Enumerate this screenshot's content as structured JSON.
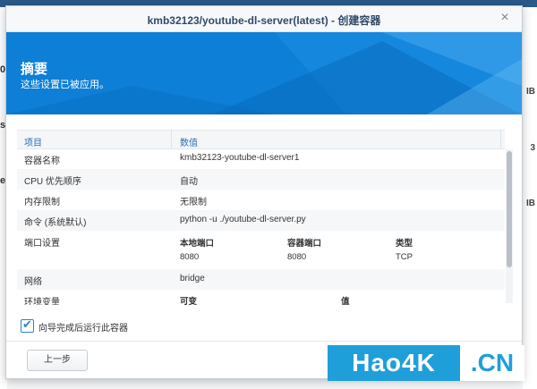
{
  "background": {
    "left_fragments": [
      "0",
      "s",
      "e"
    ],
    "right_fragments": [
      "IB",
      "3",
      "IB"
    ]
  },
  "dialog": {
    "title": "kmb32123/youtube-dl-server(latest) - 创建容器",
    "close_icon": "×",
    "banner": {
      "title": "摘要",
      "subtitle": "这些设置已被应用。"
    },
    "summary": {
      "headers": [
        "项目",
        "数值"
      ],
      "rows": [
        {
          "label": "容器名称",
          "value": "kmb32123-youtube-dl-server1"
        },
        {
          "label": "CPU 优先顺序",
          "value": "自动"
        },
        {
          "label": "内存限制",
          "value": "无限制"
        },
        {
          "label": "命令 (系统默认)",
          "value": "python -u ./youtube-dl-server.py"
        }
      ],
      "ports": {
        "label": "端口设置",
        "headers": [
          "本地端口",
          "容器端口",
          "类型"
        ],
        "values": [
          "8080",
          "8080",
          "TCP"
        ]
      },
      "network": {
        "label": "网络",
        "value": "bridge"
      },
      "env": {
        "label": "环境变量",
        "headers": [
          "可变",
          "值"
        ]
      }
    },
    "checkbox": {
      "label": "向导完成后运行此容器",
      "checked": true,
      "check_icon": "✔"
    },
    "back_button": "上一步"
  },
  "watermark": {
    "left": "Hao4K",
    "right": ".CN"
  },
  "colors": {
    "banner": "#0d7fd6",
    "accent": "#2f7fd3",
    "watermark": "#1f9fd9"
  }
}
